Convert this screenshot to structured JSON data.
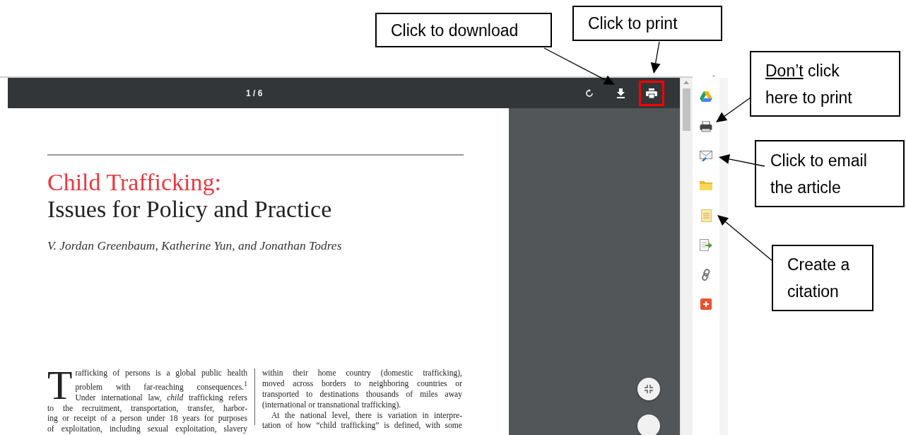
{
  "toolbar": {
    "page_indicator": "1 / 6",
    "buttons": [
      {
        "kind": "rotate",
        "highlighted": false
      },
      {
        "kind": "download",
        "highlighted": false
      },
      {
        "kind": "print",
        "highlighted": true
      }
    ]
  },
  "document": {
    "title_accent": "Child Trafficking:",
    "title": "Issues for Policy and Practice",
    "authors": "V. Jordan Greenbaum, Katherine Yun, and Jonathan Todres",
    "drop_cap": "T",
    "column_1": [
      {
        "text": "rafficking of persons is a global public health",
        "indent": false
      },
      {
        "text": "problem with far-reaching consequences.$^{1}$",
        "indent": false
      },
      {
        "text": "Under international law, *child* trafficking refers",
        "indent": false
      },
      {
        "text": "to the recruitment, transportation, transfer, harbor-",
        "indent": false
      },
      {
        "text": "ing or receipt of a person under 18 years for purposes",
        "indent": false
      },
      {
        "text": "of exploitation, including sexual exploitation, slavery",
        "indent": false
      }
    ],
    "column_2": [
      {
        "text": "within their home country (domestic trafficking),",
        "indent": false
      },
      {
        "text": "moved across borders to neighboring countries or",
        "indent": false
      },
      {
        "text": "transported to destinations thousands of miles away",
        "indent": false
      },
      {
        "text": "(international or transnational trafficking).",
        "indent": false,
        "last": true
      },
      {
        "text": "At the national level, there is variation in interpre-",
        "indent": true
      },
      {
        "text": "tation of how “child trafficking” is defined, with some",
        "indent": false
      }
    ]
  },
  "sidebar": {
    "collapse": "»",
    "tools": [
      {
        "kind": "drive"
      },
      {
        "kind": "printer"
      },
      {
        "kind": "email"
      },
      {
        "kind": "folder"
      },
      {
        "kind": "document"
      },
      {
        "kind": "export"
      },
      {
        "kind": "link"
      },
      {
        "kind": "add"
      }
    ]
  },
  "callouts": [
    {
      "text": "Click to download"
    },
    {
      "text": "Click to print"
    },
    {
      "underlined": "Don’t",
      "text": "click here to print"
    },
    {
      "text": "Click to email the article"
    },
    {
      "text": "Create a citation"
    }
  ]
}
